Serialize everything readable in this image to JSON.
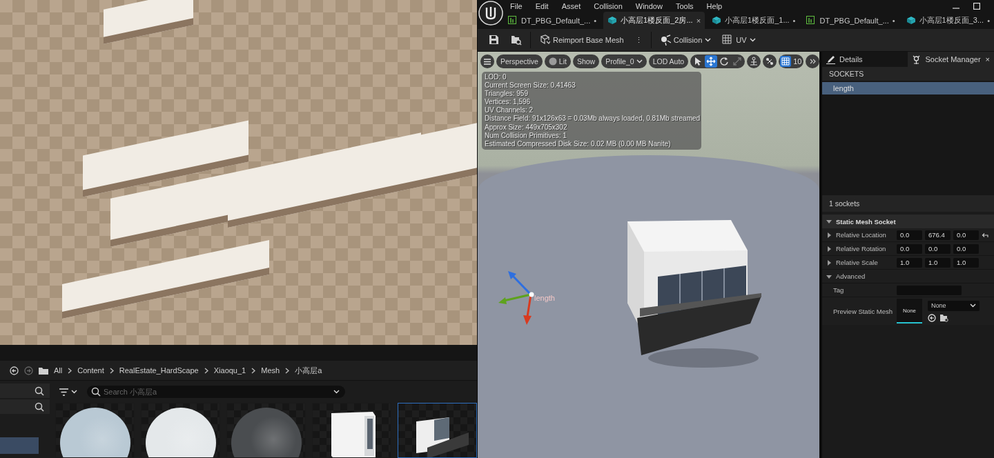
{
  "content_browser": {
    "breadcrumb": [
      "All",
      "Content",
      "RealEstate_HardScape",
      "Xiaoqu_1",
      "Mesh",
      "小高层a"
    ],
    "search": {
      "placeholder": "Search 小高层a"
    },
    "assets": [
      {
        "kind": "material",
        "color": "#b9c9d4",
        "selected": false
      },
      {
        "kind": "material",
        "color": "#e4e8ea",
        "selected": false
      },
      {
        "kind": "material",
        "color": "#4a4d50",
        "selected": false
      },
      {
        "kind": "mesh",
        "selected": false
      },
      {
        "kind": "mesh-tray",
        "selected": true
      }
    ]
  },
  "menu": [
    "File",
    "Edit",
    "Asset",
    "Collision",
    "Window",
    "Tools",
    "Help"
  ],
  "tabs": [
    {
      "label": "DT_PBG_Default_...",
      "kind": "datatable",
      "selected": false,
      "mark": "•"
    },
    {
      "label": "小高层1楼反面_2房...",
      "kind": "mesh",
      "selected": true,
      "mark": "×"
    },
    {
      "label": "小高层1楼反面_1...",
      "kind": "mesh",
      "selected": false,
      "mark": "•"
    },
    {
      "label": "DT_PBG_Default_...",
      "kind": "datatable",
      "selected": false,
      "mark": "•"
    },
    {
      "label": "小高层1楼反面_3...",
      "kind": "mesh",
      "selected": false,
      "mark": "•"
    }
  ],
  "toolbar": [
    {
      "kind": "save"
    },
    {
      "kind": "browse"
    },
    {
      "kind": "reimport",
      "label": "Reimport Base Mesh",
      "more": "⋮"
    },
    {
      "kind": "collision",
      "label": "Collision",
      "dropdown": true
    },
    {
      "kind": "uv",
      "label": "UV",
      "dropdown": true
    }
  ],
  "viewport": {
    "buttons": [
      {
        "kind": "menu"
      },
      {
        "kind": "text",
        "label": "Perspective"
      },
      {
        "kind": "lit",
        "label": "Lit"
      },
      {
        "kind": "text",
        "label": "Show"
      },
      {
        "kind": "dropdown",
        "label": "Profile_0"
      },
      {
        "kind": "text",
        "label": "LOD Auto"
      }
    ],
    "tools": [
      {
        "kind": "select",
        "selected": false
      },
      {
        "kind": "move",
        "selected": true
      },
      {
        "kind": "rotate",
        "selected": false
      },
      {
        "kind": "scale",
        "selected": false
      }
    ],
    "grid_snap": {
      "on": true,
      "value": "10"
    },
    "stats": [
      "LOD:  0",
      "Current Screen Size:  0.41463",
      "Triangles:  959",
      "Vertices:  1,596",
      "UV Channels:  2",
      "Distance Field:  91x126x63 = 0.03Mb always loaded, 0.81Mb streamed",
      "Approx Size: 449x705x302",
      "Num Collision Primitives:  1",
      "Estimated Compressed Disk Size: 0.02 MB (0.00 MB Nanite)"
    ],
    "socket_label": "length"
  },
  "panel": {
    "tabs": [
      {
        "label": "Details",
        "kind": "details",
        "selected": false
      },
      {
        "label": "Socket Manager",
        "kind": "sockets",
        "selected": true,
        "close": "×"
      }
    ],
    "sockets_header": "SOCKETS",
    "sockets": [
      {
        "name": "length",
        "selected": true
      }
    ],
    "count": "1 sockets",
    "section": {
      "title": "Static Mesh Socket",
      "expanded": true,
      "properties": [
        {
          "kind": "vector",
          "label": "Relative Location",
          "values": [
            "0.0",
            "676.4",
            "0.0"
          ],
          "reset": true,
          "expanded": false
        },
        {
          "kind": "vector",
          "label": "Relative Rotation",
          "values": [
            "0.0",
            "0.0",
            "0.0"
          ],
          "reset": false,
          "expanded": false
        },
        {
          "kind": "vector",
          "label": "Relative Scale",
          "values": [
            "1.0",
            "1.0",
            "1.0"
          ],
          "reset": false,
          "expanded": false
        },
        {
          "kind": "group",
          "label": "Advanced",
          "expanded": true
        },
        {
          "kind": "text",
          "label": "Tag"
        },
        {
          "kind": "asset",
          "label": "Preview Static Mesh",
          "thumb": "None",
          "value": "None"
        }
      ]
    }
  }
}
